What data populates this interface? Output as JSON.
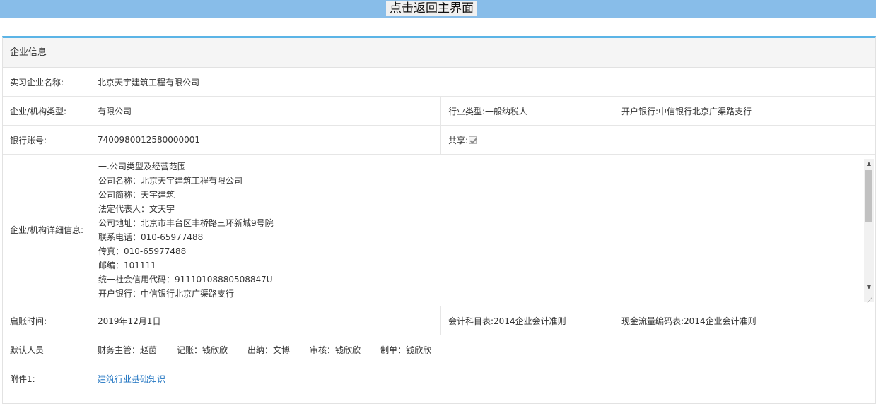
{
  "topbar": {
    "back_label": "点击返回主界面"
  },
  "panel": {
    "title": "企业信息"
  },
  "rows": {
    "company_name": {
      "label": "实习企业名称:",
      "value": "北京天宇建筑工程有限公司"
    },
    "org_type": {
      "label": "企业/机构类型:",
      "value": "有限公司",
      "industry": "行业类型:一般纳税人",
      "bank": "开户银行:中信银行北京广渠路支行"
    },
    "bank_account": {
      "label": "银行账号:",
      "value": "7400980012580000001",
      "share_label": "共享:",
      "share_checked": true
    },
    "detail": {
      "label": "企业/机构详细信息:",
      "lines": [
        "一.公司类型及经营范围",
        "公司名称：北京天宇建筑工程有限公司",
        "公司简称：天宇建筑",
        "法定代表人：文天宇",
        "公司地址：北京市丰台区丰桥路三环新城9号院",
        "联系电话：010-65977488",
        "传真：010-65977488",
        "邮编：101111",
        "统一社会信用代码：91110108880508847U",
        "开户银行：中信银行北京广渠路支行"
      ]
    },
    "start_date": {
      "label": "启账时间:",
      "value": "2019年12月1日",
      "subject_table": "会计科目表:2014企业会计准则",
      "cashflow_table": "现金流量编码表:2014企业会计准则"
    },
    "default_staff": {
      "label": "默认人员",
      "people": [
        "财务主管：赵茵",
        "记账：钱欣欣",
        "出纳：文博",
        "审核：钱欣欣",
        "制单：钱欣欣"
      ]
    },
    "attachment": {
      "label": "附件1:",
      "link": "建筑行业基础知识"
    }
  }
}
